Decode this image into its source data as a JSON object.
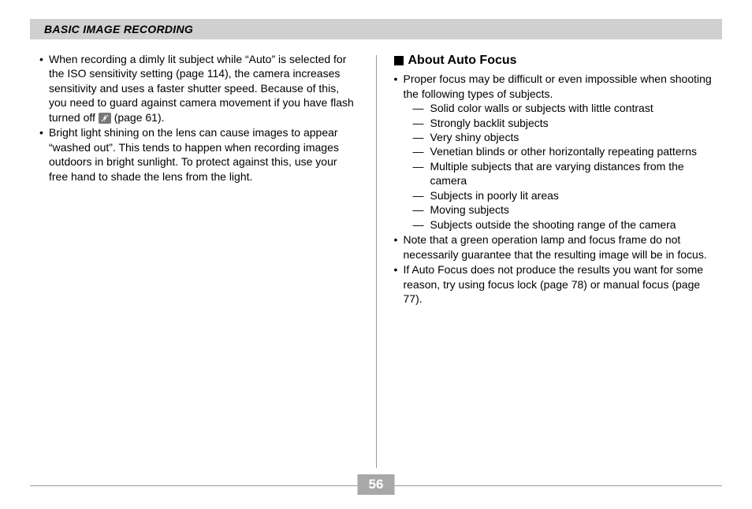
{
  "header": {
    "title": "BASIC IMAGE RECORDING"
  },
  "left": {
    "bullets": [
      {
        "pre": "When recording a dimly lit subject while “Auto” is selected for the ISO sensitivity setting (page 114), the camera increases sensitivity and uses a faster shutter speed. Because of this, you need to guard against camera movement if you have flash turned off ",
        "post": " (page 61)."
      },
      {
        "pre": "Bright light shining on the lens can cause images to appear “washed out”. This tends to happen when recording images outdoors in bright sunlight. To protect against this, use your free hand to shade the lens from the light.",
        "post": ""
      }
    ]
  },
  "right": {
    "subheading": "About Auto Focus",
    "intro": "Proper focus may be difficult or even impossible when shooting the following types of subjects.",
    "dashes": [
      "Solid color walls or subjects with little contrast",
      "Strongly backlit subjects",
      "Very shiny objects",
      "Venetian blinds or other horizontally repeating patterns",
      "Multiple subjects that are varying distances from the camera",
      "Subjects in poorly lit areas",
      "Moving subjects",
      "Subjects outside the shooting range of the camera"
    ],
    "bullets_after": [
      "Note that a green operation lamp and focus frame do not necessarily guarantee that the resulting image will be in focus.",
      "If Auto Focus does not produce the results you want for some reason, try using focus lock (page 78) or manual focus (page 77)."
    ]
  },
  "footer": {
    "page": "56"
  }
}
